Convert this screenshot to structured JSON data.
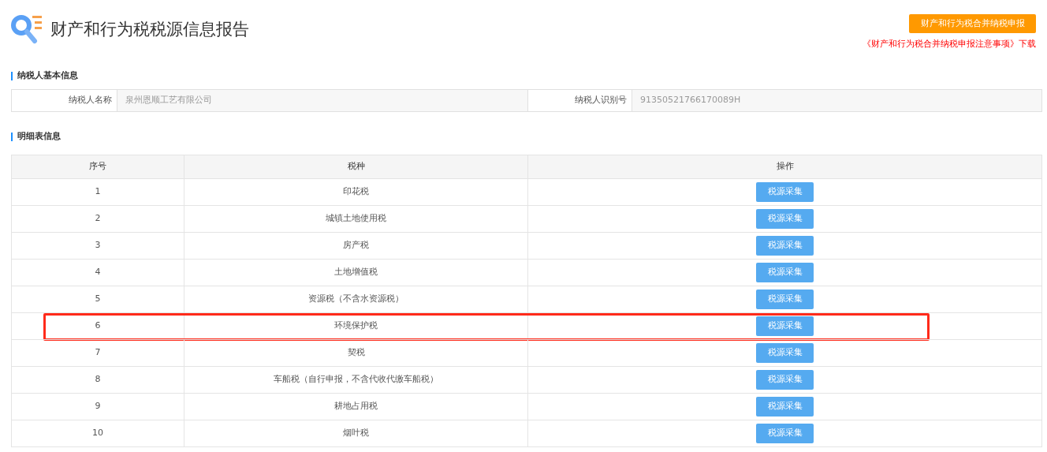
{
  "title": "财产和行为税税源信息报告",
  "declare_button": "财产和行为税合并纳税申报",
  "notice_link": "《财产和行为税合并纳税申报注意事项》下载",
  "taxpayer_section": {
    "heading": "纳税人基本信息",
    "fields": [
      {
        "label": "纳税人名称",
        "value": "泉州恩顺工艺有限公司"
      },
      {
        "label": "纳税人识别号",
        "value": "91350521766170089H"
      }
    ]
  },
  "detail_section": {
    "heading": "明细表信息",
    "columns": [
      "序号",
      "税种",
      "操作"
    ],
    "rows": [
      {
        "no": "1",
        "tax": "印花税",
        "action": "税源采集",
        "highlighted": false
      },
      {
        "no": "2",
        "tax": "城镇土地使用税",
        "action": "税源采集",
        "highlighted": false
      },
      {
        "no": "3",
        "tax": "房产税",
        "action": "税源采集",
        "highlighted": false
      },
      {
        "no": "4",
        "tax": "土地增值税",
        "action": "税源采集",
        "highlighted": false
      },
      {
        "no": "5",
        "tax": "资源税（不含水资源税）",
        "action": "税源采集",
        "highlighted": false
      },
      {
        "no": "6",
        "tax": "环境保护税",
        "action": "税源采集",
        "highlighted": true
      },
      {
        "no": "7",
        "tax": "契税",
        "action": "税源采集",
        "highlighted": false
      },
      {
        "no": "8",
        "tax": "车船税（自行申报，不含代收代缴车船税）",
        "action": "税源采集",
        "highlighted": false
      },
      {
        "no": "9",
        "tax": "耕地占用税",
        "action": "税源采集",
        "highlighted": false
      },
      {
        "no": "10",
        "tax": "烟叶税",
        "action": "税源采集",
        "highlighted": false
      }
    ]
  }
}
